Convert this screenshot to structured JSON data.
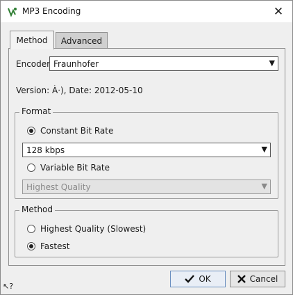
{
  "window": {
    "title": "MP3 Encoding"
  },
  "tabs": [
    {
      "label": "Method"
    },
    {
      "label": "Advanced"
    }
  ],
  "encoder": {
    "label": "Encoder",
    "value": "Fraunhofer"
  },
  "version_text": "Version: À·), Date: 2012-05-10",
  "format": {
    "title": "Format",
    "constant_label": "Constant Bit Rate",
    "constant_value": "128 kbps",
    "variable_label": "Variable Bit Rate",
    "variable_value": "Highest Quality"
  },
  "method": {
    "title": "Method",
    "highest_label": "Highest Quality (Slowest)",
    "fastest_label": "Fastest"
  },
  "buttons": {
    "ok": "OK",
    "cancel": "Cancel"
  },
  "help": "?"
}
